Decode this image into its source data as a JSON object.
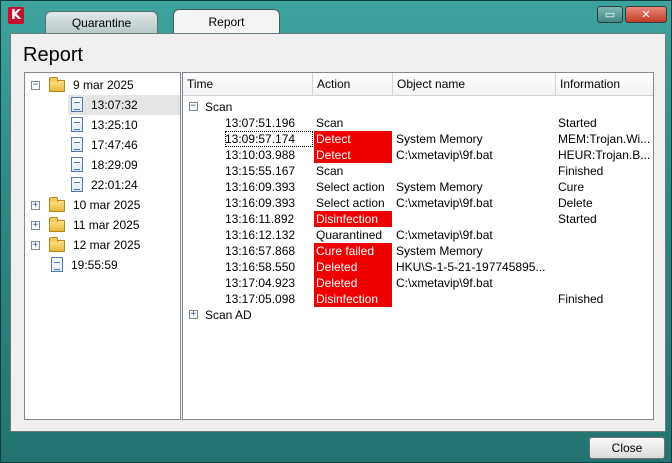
{
  "window": {
    "logo_letter": "K",
    "tabs": [
      {
        "label": "Quarantine",
        "active": false
      },
      {
        "label": "Report",
        "active": true
      }
    ],
    "min_glyph": "▭",
    "close_glyph": "✕"
  },
  "panel": {
    "title": "Report"
  },
  "tree": {
    "items": [
      {
        "kind": "folder",
        "expanded": true,
        "label": "9 mar 2025"
      },
      {
        "kind": "report",
        "label": "13:07:32",
        "selected": true
      },
      {
        "kind": "report",
        "label": "13:25:10"
      },
      {
        "kind": "report",
        "label": "17:47:46"
      },
      {
        "kind": "report",
        "label": "18:29:09"
      },
      {
        "kind": "report",
        "label": "22:01:24"
      },
      {
        "kind": "folder",
        "expanded": false,
        "label": "10 mar 2025"
      },
      {
        "kind": "folder",
        "expanded": false,
        "label": "11 mar 2025"
      },
      {
        "kind": "folder",
        "expanded": false,
        "label": "12 mar 2025"
      },
      {
        "kind": "report-root",
        "label": "19:55:59"
      }
    ]
  },
  "grid": {
    "columns": [
      "Time",
      "Action",
      "Object name",
      "Information"
    ],
    "groups": [
      {
        "label": "Scan",
        "expanded": true
      },
      {
        "label": "Scan AD",
        "expanded": false
      }
    ],
    "rows": [
      {
        "time": "13:07:51.196",
        "action": "Scan",
        "object": "",
        "info": "Started",
        "alert": false
      },
      {
        "time": "13:09:57.174",
        "action": "Detect",
        "object": "System Memory",
        "info": "MEM:Trojan.Wi...",
        "alert": true
      },
      {
        "time": "13:10:03.988",
        "action": "Detect",
        "object": "C:\\xmetavip\\9f.bat",
        "info": "HEUR:Trojan.B...",
        "alert": true
      },
      {
        "time": "13:15:55.167",
        "action": "Scan",
        "object": "",
        "info": "Finished",
        "alert": false
      },
      {
        "time": "13:16:09.393",
        "action": "Select action",
        "object": "System Memory",
        "info": "Cure",
        "alert": false
      },
      {
        "time": "13:16:09.393",
        "action": "Select action",
        "object": "C:\\xmetavip\\9f.bat",
        "info": "Delete",
        "alert": false
      },
      {
        "time": "13:16:11.892",
        "action": "Disinfection",
        "object": "",
        "info": "Started",
        "alert": true
      },
      {
        "time": "13:16:12.132",
        "action": "Quarantined",
        "object": "C:\\xmetavip\\9f.bat",
        "info": "",
        "alert": false
      },
      {
        "time": "13:16:57.868",
        "action": "Cure failed",
        "object": "System Memory",
        "info": "",
        "alert": true
      },
      {
        "time": "13:16:58.550",
        "action": "Deleted",
        "object": "HKU\\S-1-5-21-197745895...",
        "info": "",
        "alert": true
      },
      {
        "time": "13:17:04.923",
        "action": "Deleted",
        "object": "C:\\xmetavip\\9f.bat",
        "info": "",
        "alert": true
      },
      {
        "time": "13:17:05.098",
        "action": "Disinfection",
        "object": "",
        "info": "Finished",
        "alert": true
      }
    ]
  },
  "footer": {
    "close_label": "Close"
  },
  "colors": {
    "alert_red": "#ee0000",
    "chrome_teal": "#2e8a84"
  }
}
